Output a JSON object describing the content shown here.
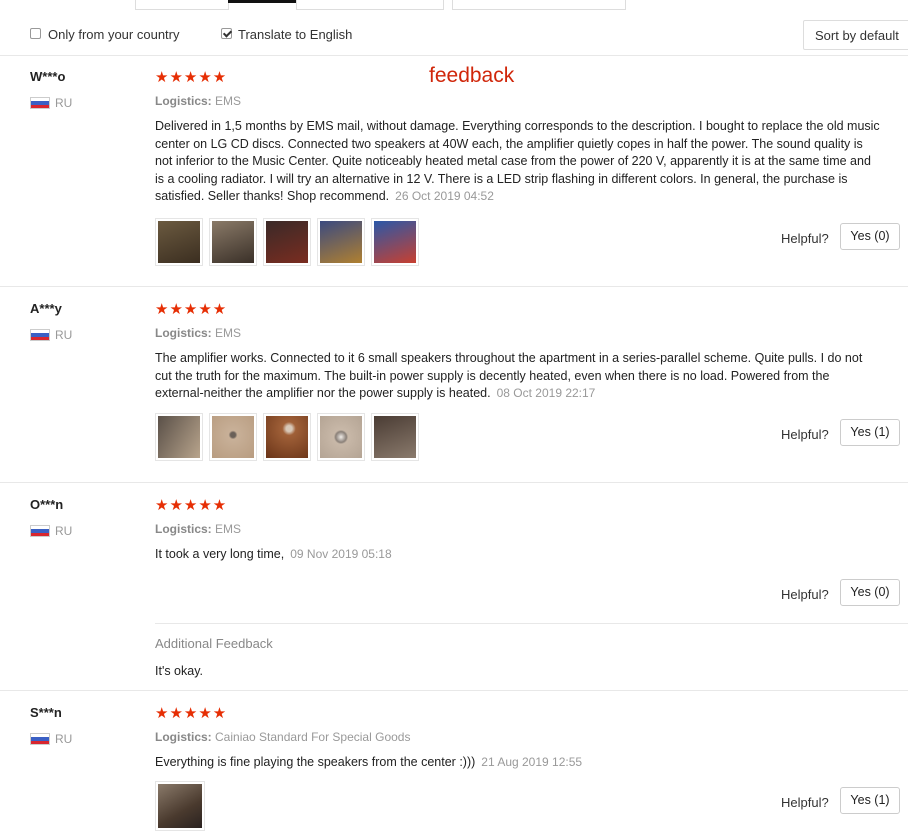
{
  "filters": {
    "only_country_label": "Only from your country",
    "only_country_checked": false,
    "translate_label": "Translate to English",
    "translate_checked": true,
    "sort_label": "Sort by default"
  },
  "annotation": "feedback",
  "rating_stars": "★★★★★",
  "logistics_label": "Logistics:",
  "helpful_label": "Helpful?",
  "reviews": [
    {
      "user": "W***o",
      "country": "RU",
      "stars": 5,
      "logistics": "EMS",
      "text": "Delivered in 1,5 months by EMS mail, without damage. Everything corresponds to the description. I bought to replace the old music center on LG CD discs. Connected two speakers at 40W each, the amplifier quietly copes in half the power. The sound quality is not inferior to the Music Center. Quite noticeably heated metal case from the power of 220 V, apparently it is at the same time and is a cooling radiator. I will try an alternative in 12 V. There is a LED strip flashing in different colors. In general, the purchase is satisfied. Seller thanks! Shop recommend.",
      "date": "26 Oct 2019 04:52",
      "helpful_btn": "Yes (0)",
      "photos": [
        "#6b5a40",
        "#8a7a68",
        "#3a2a28",
        "#3b4a80",
        "#2a58a8"
      ]
    },
    {
      "user": "A***y",
      "country": "RU",
      "stars": 5,
      "logistics": "EMS",
      "text": "The amplifier works. Connected to it 6 small speakers throughout the apartment in a series-parallel scheme. Quite pulls. I do not cut the truth for the maximum. The built-in power supply is decently heated, even when there is no load. Powered from the external-neither the amplifier nor the power supply is heated.",
      "date": "08 Oct 2019 22:17",
      "helpful_btn": "Yes (1)",
      "photos": [
        "#a08a70",
        "#c2aa90",
        "#a86a40",
        "#c8b8a8",
        "#4a3c34"
      ]
    },
    {
      "user": "O***n",
      "country": "RU",
      "stars": 5,
      "logistics": "EMS",
      "text": "It took a very long time,",
      "date": "09 Nov 2019 05:18",
      "helpful_btn": "Yes (0)",
      "additional_title": "Additional Feedback",
      "additional_text": "It's okay."
    },
    {
      "user": "S***n",
      "country": "RU",
      "stars": 5,
      "logistics": "Cainiao Standard For Special Goods",
      "text": "Everything is fine playing the speakers from the center :)))",
      "date": "21 Aug 2019 12:55",
      "helpful_btn": "Yes (1)",
      "photos": [
        "#6a5a4a"
      ]
    }
  ],
  "flag_colors": [
    "#ffffff",
    "#3a5fc4",
    "#d8262e"
  ],
  "accent_color": "#e62e04"
}
